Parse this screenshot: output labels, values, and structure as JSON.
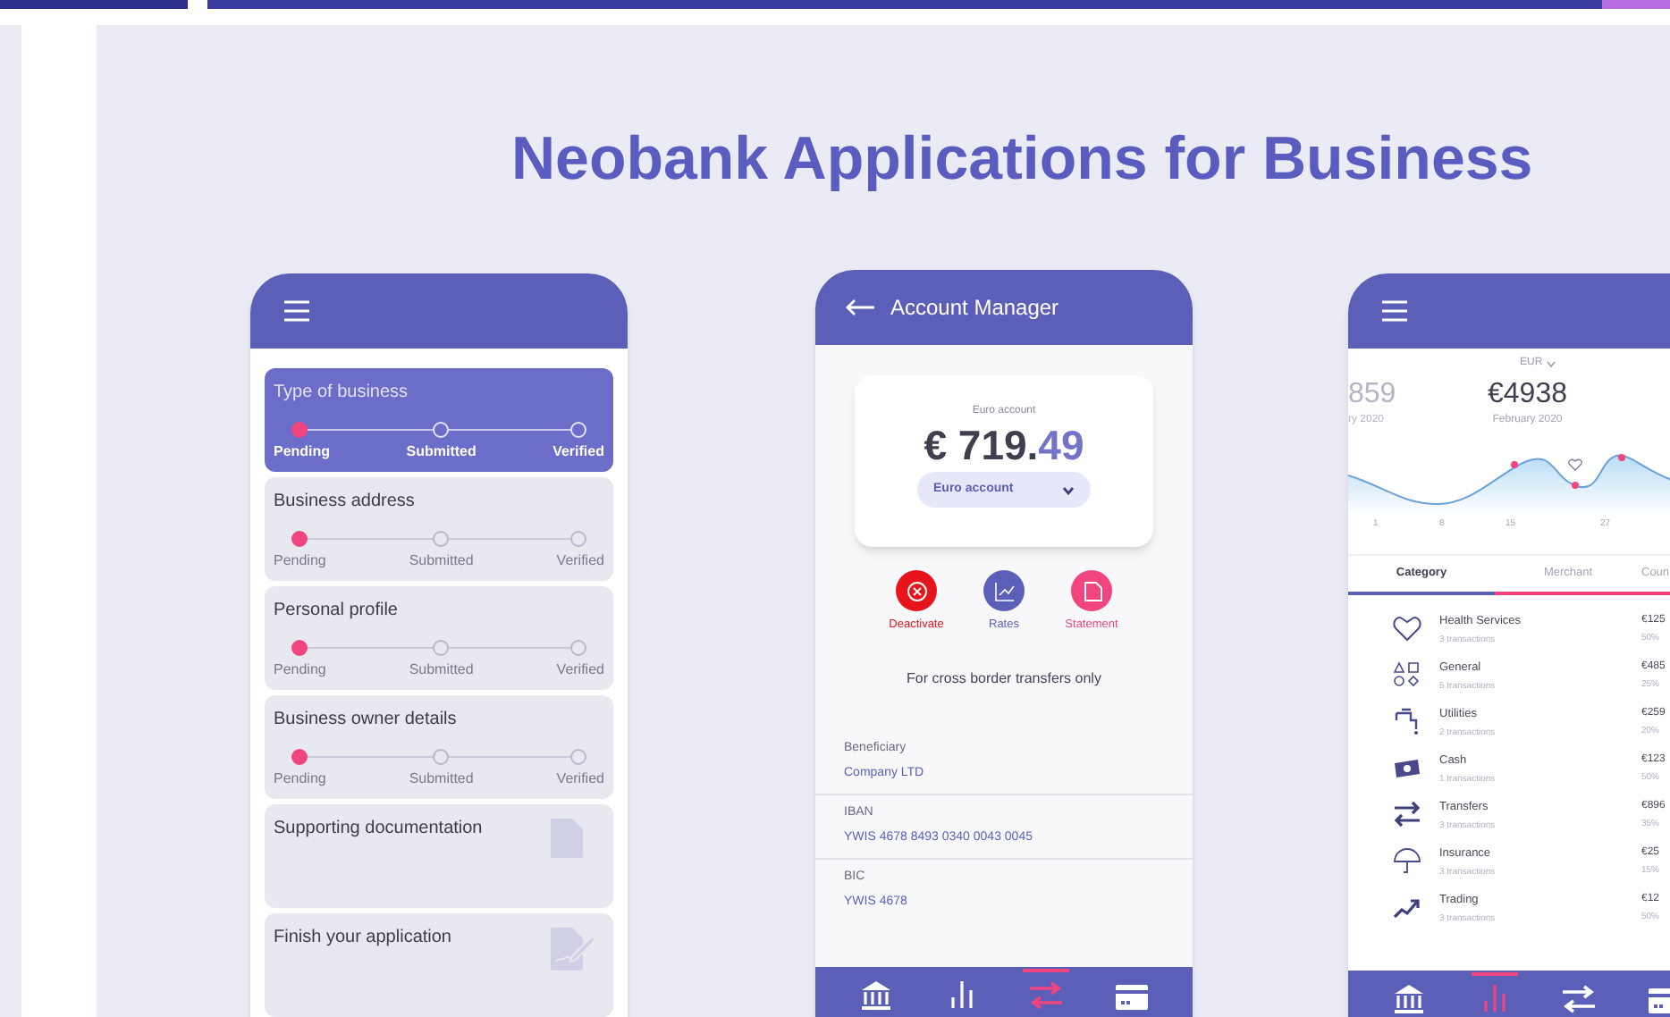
{
  "page_title": "Neobank Applications for Business",
  "onboarding_phone": {
    "steps": [
      {
        "title": "Type of business",
        "selected": true,
        "kind": "progress",
        "stages": [
          {
            "label": "Pending",
            "done": true
          },
          {
            "label": "Submitted",
            "done": false
          },
          {
            "label": "Verified",
            "done": false
          }
        ]
      },
      {
        "title": "Business address",
        "selected": false,
        "kind": "progress",
        "stages": [
          {
            "label": "Pending",
            "done": true
          },
          {
            "label": "Submitted",
            "done": false
          },
          {
            "label": "Verified",
            "done": false
          }
        ]
      },
      {
        "title": "Personal profile",
        "selected": false,
        "kind": "progress",
        "stages": [
          {
            "label": "Pending",
            "done": true
          },
          {
            "label": "Submitted",
            "done": false
          },
          {
            "label": "Verified",
            "done": false
          }
        ]
      },
      {
        "title": "Business owner details",
        "selected": false,
        "kind": "progress",
        "stages": [
          {
            "label": "Pending",
            "done": true
          },
          {
            "label": "Submitted",
            "done": false
          },
          {
            "label": "Verified",
            "done": false
          }
        ]
      },
      {
        "title": "Supporting documentation",
        "selected": false,
        "kind": "document"
      },
      {
        "title": "Finish your application",
        "selected": false,
        "kind": "signature"
      }
    ]
  },
  "account_phone": {
    "title": "Account Manager",
    "account_label": "Euro account",
    "amount_main": "€ 719.",
    "amount_cents": "49",
    "account_select": "Euro account",
    "actions": [
      {
        "label": "Deactivate",
        "kind": "deactivate",
        "color": "#e8141b"
      },
      {
        "label": "Rates",
        "kind": "rates",
        "color": "#5b5fb8"
      },
      {
        "label": "Statement",
        "kind": "statement",
        "color": "#f0457e"
      }
    ],
    "note": "For cross border transfers only",
    "fields": [
      {
        "label": "Beneficiary",
        "value": "Company LTD"
      },
      {
        "label": "IBAN",
        "value": "YWIS 4678 8493 0340 0043 0045"
      },
      {
        "label": "BIC",
        "value": "YWIS 4678"
      }
    ],
    "nav": [
      {
        "kind": "bank",
        "selected": false
      },
      {
        "kind": "analytics",
        "selected": false
      },
      {
        "kind": "transfer",
        "selected": true
      },
      {
        "kind": "card",
        "selected": false
      }
    ]
  },
  "analytics_phone": {
    "currency": "EUR",
    "previous_amount": "859",
    "previous_period": "ry 2020",
    "amount": "€4938",
    "period": "February 2020",
    "x_labels": [
      "1",
      "8",
      "15",
      "27"
    ],
    "tabs": [
      {
        "label": "Category",
        "selected": true
      },
      {
        "label": "Merchant",
        "selected": false
      },
      {
        "label": "Coun",
        "selected": false
      }
    ],
    "categories": [
      {
        "kind": "heart",
        "name": "Health Services",
        "count": "3 transactions",
        "amount": "€125",
        "share": "50%"
      },
      {
        "kind": "shapes",
        "name": "General",
        "count": "5 transactions",
        "amount": "€485",
        "share": "25%"
      },
      {
        "kind": "tap",
        "name": "Utilities",
        "count": "2 transactions",
        "amount": "€259",
        "share": "20%"
      },
      {
        "kind": "cash",
        "name": "Cash",
        "count": "1 transactions",
        "amount": "€123",
        "share": "50%"
      },
      {
        "kind": "transfer",
        "name": "Transfers",
        "count": "3 transactions",
        "amount": "€896",
        "share": "35%"
      },
      {
        "kind": "umbrella",
        "name": "Insurance",
        "count": "3 transactions",
        "amount": "€25",
        "share": "15%"
      },
      {
        "kind": "trend",
        "name": "Trading",
        "count": "3 transactions",
        "amount": "€12",
        "share": "50%"
      }
    ],
    "nav": [
      {
        "kind": "bank",
        "selected": false
      },
      {
        "kind": "analytics",
        "selected": true
      },
      {
        "kind": "transfer",
        "selected": false
      },
      {
        "kind": "card",
        "selected": false
      }
    ]
  }
}
